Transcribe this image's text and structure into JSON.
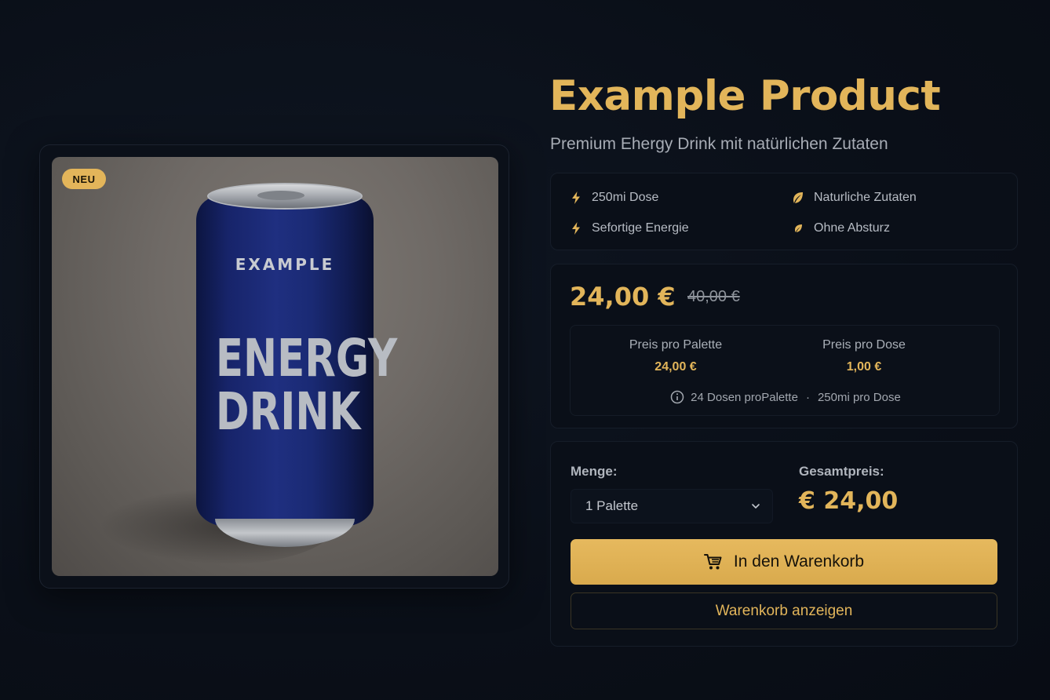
{
  "product": {
    "title": "Example Product",
    "subtitle": "Premium Ehergy Drink mit natürlichen Zutaten",
    "badge": "NEU",
    "image": {
      "can_brand": "EXAMPLE",
      "can_title_line1": "ENERGY",
      "can_title_line2": "DRINK"
    }
  },
  "features": [
    {
      "label": "250mi Dose",
      "icon": "lightning-icon"
    },
    {
      "label": "Naturliche Zutaten",
      "icon": "leaf-icon"
    },
    {
      "label": "Sefortige Energie",
      "icon": "lightning-icon"
    },
    {
      "label": "Ohne Absturz",
      "icon": "leaf-icon"
    }
  ],
  "pricing": {
    "current": "24,00 €",
    "old": "40,00 €",
    "per_pallet_label": "Preis pro Palette",
    "per_pallet_value": "24,00 €",
    "per_can_label": "Preis pro Dose",
    "per_can_value": "1,00 €",
    "info_cans": "24 Dosen proPalette",
    "info_separator": "·",
    "info_volume": "250mi pro Dose"
  },
  "cart": {
    "quantity_label": "Menge:",
    "quantity_value": "1 Palette",
    "total_label": "Gesamtpreis:",
    "total_value": "€ 24,00",
    "add_button": "In den Warenkorb",
    "view_button": "Warenkorb anzeigen"
  },
  "colors": {
    "accent": "#e2b55a",
    "background": "#0a0f18",
    "can_blue": "#1f2f80"
  }
}
